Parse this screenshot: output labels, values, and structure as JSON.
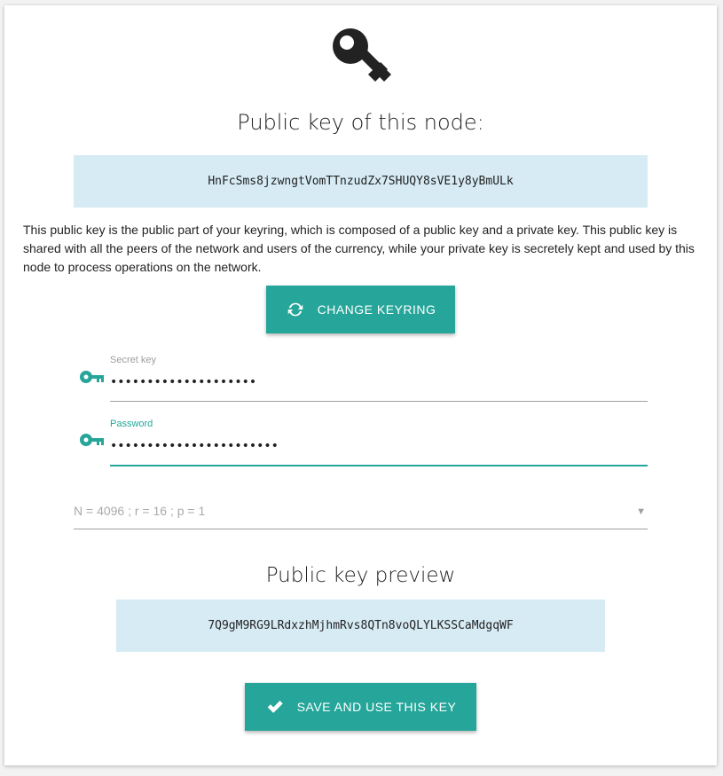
{
  "header": {
    "logo_icon": "key-icon",
    "title": "Public key of this node:"
  },
  "node_key": {
    "value": "HnFcSms8jzwngtVomTTnzudZx7SHUQY8sVE1y8yBmULk"
  },
  "description": "This public key is the public part of your keyring, which is composed of a public key and a private key. This public key is shared with all the peers of the network and users of the currency, while your private key is secretely kept and used by this node to process operations on the network.",
  "change_button": {
    "label": "CHANGE KEYRING",
    "icon": "refresh-icon"
  },
  "form": {
    "secret_key": {
      "label": "Secret key",
      "value": "••••••••••••••••••••",
      "icon": "key-icon"
    },
    "password": {
      "label": "Password",
      "value": "•••••••••••••••••••••••",
      "icon": "key-icon"
    },
    "params": {
      "selected": "N = 4096 ; r = 16 ; p = 1"
    }
  },
  "preview": {
    "title": "Public key preview",
    "value": "7Q9gM9RG9LRdxzhMjhmRvs8QTn8voQLYLKSSCaMdgqWF"
  },
  "save_button": {
    "label": "SAVE AND USE THIS KEY",
    "icon": "check-icon"
  },
  "colors": {
    "accent": "#26a69a",
    "keybox_bg": "#d6ebf4"
  }
}
